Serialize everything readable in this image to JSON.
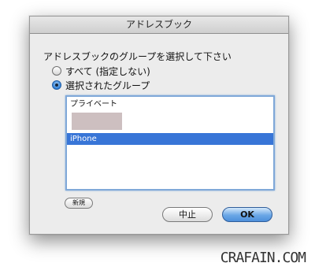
{
  "window": {
    "title": "アドレスブック"
  },
  "prompt": "アドレスブックのグループを選択して下さい",
  "options": [
    {
      "label": "すべて (指定しない)",
      "selected": false
    },
    {
      "label": "選択されたグループ",
      "selected": true
    }
  ],
  "groups": [
    {
      "label": "プライベート",
      "selected": false
    },
    {
      "label": "iPhone",
      "selected": true
    }
  ],
  "buttons": {
    "new": "新規",
    "cancel": "中止",
    "ok": "OK"
  },
  "watermark": "CRAFAIN.COM",
  "colors": {
    "selection": "#3875d7",
    "default_button": "#4d8fdb"
  }
}
